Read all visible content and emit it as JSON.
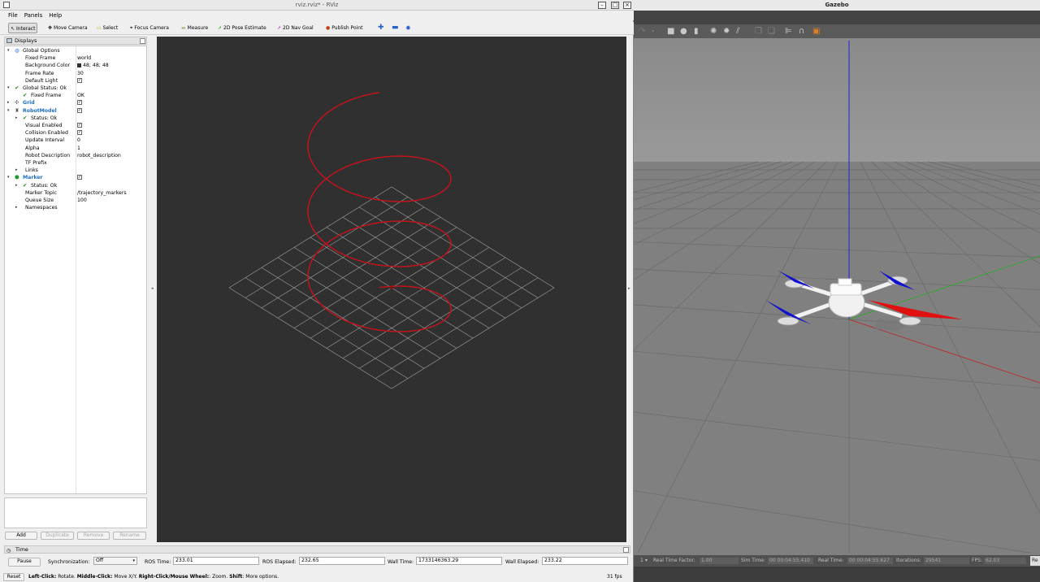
{
  "rviz": {
    "title": "rviz.rviz* - RViz",
    "menu": [
      "File",
      "Panels",
      "Help"
    ],
    "toolbar": [
      {
        "label": "Interact",
        "icon": "interact-icon",
        "glyph": "↖"
      },
      {
        "label": "Move Camera",
        "icon": "move-camera-icon",
        "glyph": "✥"
      },
      {
        "label": "Select",
        "icon": "select-icon",
        "glyph": "▭"
      },
      {
        "label": "Focus Camera",
        "icon": "focus-camera-icon",
        "glyph": "⌖"
      },
      {
        "label": "Measure",
        "icon": "measure-icon",
        "glyph": "▬"
      },
      {
        "label": "2D Pose Estimate",
        "icon": "pose-estimate-icon",
        "glyph": "➚"
      },
      {
        "label": "2D Nav Goal",
        "icon": "nav-goal-icon",
        "glyph": "➚"
      },
      {
        "label": "Publish Point",
        "icon": "publish-point-icon",
        "glyph": "●"
      }
    ],
    "displays_title": "Displays",
    "tree": [
      {
        "label": "Global Options",
        "value": "",
        "depth": 0,
        "arrow": "▾",
        "icon": "globe-icon",
        "glyph": "◍",
        "icon_color": "#3a7bd5",
        "style": ""
      },
      {
        "label": "Fixed Frame",
        "value": "world",
        "depth": 1
      },
      {
        "label": "Background Color",
        "value": "48; 48; 48",
        "depth": 1,
        "swatch": true
      },
      {
        "label": "Frame Rate",
        "value": "30",
        "depth": 1
      },
      {
        "label": "Default Light",
        "value": "",
        "depth": 1,
        "check": true
      },
      {
        "label": "Global Status: Ok",
        "value": "",
        "depth": 0,
        "arrow": "▾",
        "icon": "ok-check-icon",
        "glyph": "✔",
        "icon_color": "#1a8a1a",
        "style": ""
      },
      {
        "label": "Fixed Frame",
        "value": "OK",
        "depth": 1,
        "icon": "ok-check-icon",
        "glyph": "✔",
        "icon_color": "#1a8a1a"
      },
      {
        "label": "Grid",
        "value": "",
        "depth": 0,
        "arrow": "▸",
        "icon": "grid-icon",
        "glyph": "✣",
        "icon_color": "#555",
        "style": "blue",
        "check": true
      },
      {
        "label": "RobotModel",
        "value": "",
        "depth": 0,
        "arrow": "▾",
        "icon": "robot-model-icon",
        "glyph": "♜",
        "icon_color": "#555",
        "style": "blue",
        "check": true
      },
      {
        "label": "Status: Ok",
        "value": "",
        "depth": 1,
        "arrow": "▸",
        "icon": "ok-check-icon",
        "glyph": "✔",
        "icon_color": "#1a8a1a"
      },
      {
        "label": "Visual Enabled",
        "value": "",
        "depth": 1,
        "check": true
      },
      {
        "label": "Collision Enabled",
        "value": "",
        "depth": 1,
        "check": true
      },
      {
        "label": "Update Interval",
        "value": "0",
        "depth": 1
      },
      {
        "label": "Alpha",
        "value": "1",
        "depth": 1
      },
      {
        "label": "Robot Description",
        "value": "robot_description",
        "depth": 1
      },
      {
        "label": "TF Prefix",
        "value": "",
        "depth": 1
      },
      {
        "label": "Links",
        "value": "",
        "depth": 1,
        "arrow": "▸"
      },
      {
        "label": "Marker",
        "value": "",
        "depth": 0,
        "arrow": "▾",
        "icon": "marker-icon",
        "glyph": "⬢",
        "icon_color": "#1a9a2a",
        "style": "blue",
        "check": true
      },
      {
        "label": "Status: Ok",
        "value": "",
        "depth": 1,
        "arrow": "▸",
        "icon": "ok-check-icon",
        "glyph": "✔",
        "icon_color": "#1a8a1a"
      },
      {
        "label": "Marker Topic",
        "value": "/trajectory_markers",
        "depth": 1
      },
      {
        "label": "Queue Size",
        "value": "100",
        "depth": 1
      },
      {
        "label": "Namespaces",
        "value": "",
        "depth": 1,
        "arrow": "▸"
      }
    ],
    "panel_buttons": [
      "Add",
      "Duplicate",
      "Remove",
      "Rename"
    ],
    "time": {
      "title": "Time",
      "pause": "Pause",
      "sync_label": "Synchronization:",
      "sync_value": "Off",
      "ros_time_label": "ROS Time:",
      "ros_time": "233.01",
      "ros_elapsed_label": "ROS Elapsed:",
      "ros_elapsed": "232.65",
      "wall_time_label": "Wall Time:",
      "wall_time": "1733146363.29",
      "wall_elapsed_label": "Wall Elapsed:",
      "wall_elapsed": "233.22"
    },
    "status": {
      "reset": "Reset",
      "left_bold": "Left-Click:",
      "left": " Rotate. ",
      "middle_bold": "Middle-Click:",
      "middle": " Move X/Y. ",
      "right_bold": "Right-Click/Mouse Wheel:",
      "right": ": Zoom. ",
      "shift_bold": "Shift",
      "shift": ": More options.",
      "fps": "31 fps"
    },
    "colors": {
      "background": "#303030",
      "trajectory": "#c0141c",
      "grid": "#a0a0a0"
    }
  },
  "gazebo": {
    "title": "Gazebo",
    "status": {
      "step": "1",
      "rtf_label": "Real Time Factor:",
      "rtf": "1.00",
      "sim_label": "Sim Time:",
      "sim": "00 00:04:55.410",
      "real_label": "Real Time:",
      "real": "00 00:04:55.627",
      "iter_label": "Iterations:",
      "iter": "29541",
      "fps_label": "FPS:",
      "fps": "62.03",
      "reset": "Re"
    }
  }
}
